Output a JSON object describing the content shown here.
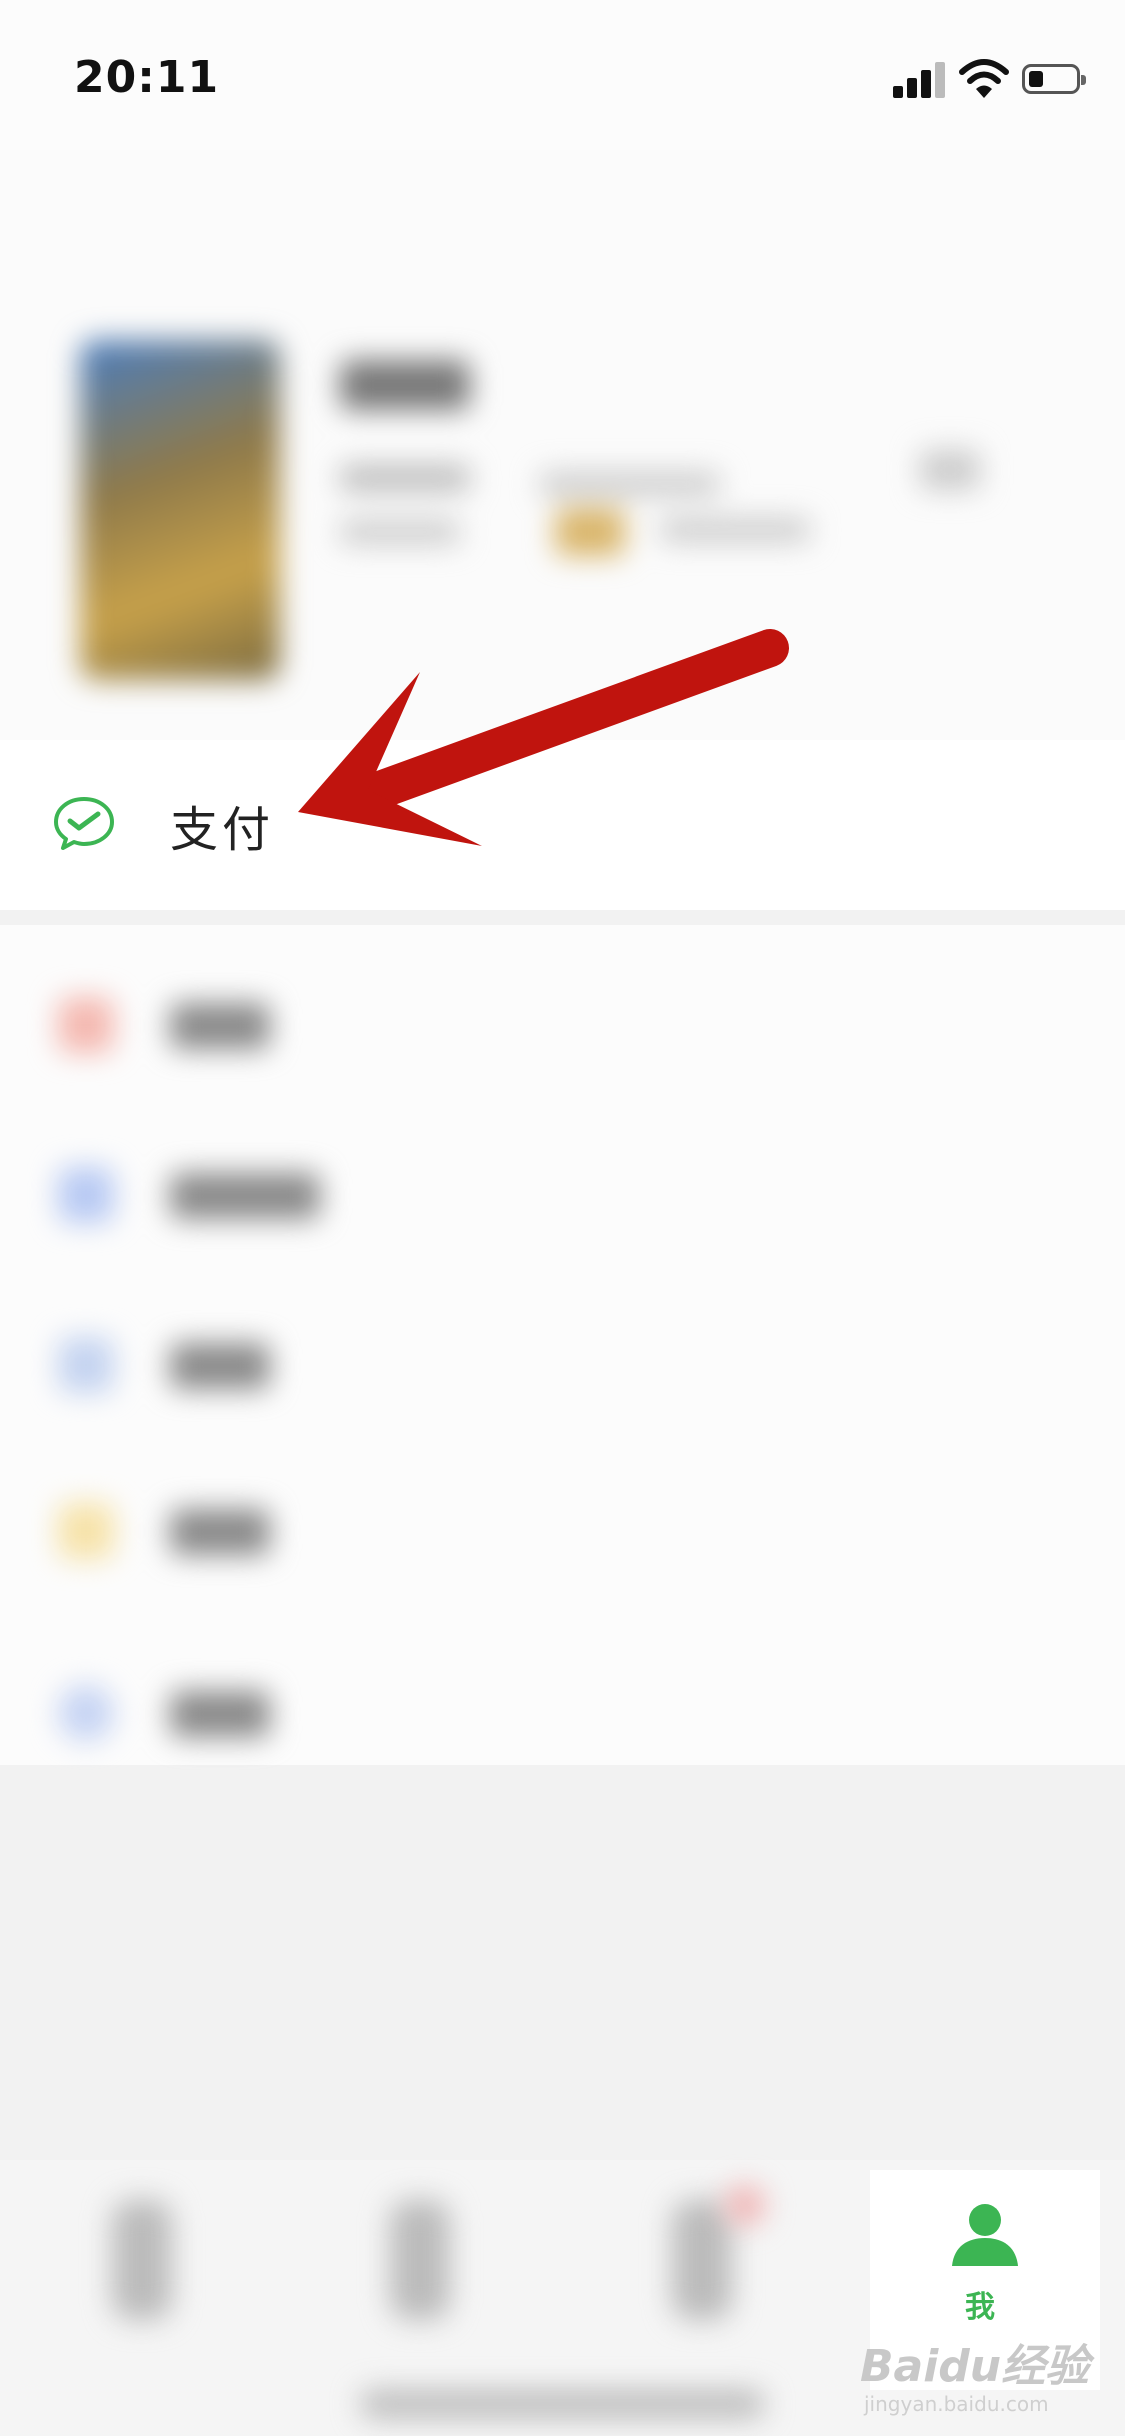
{
  "status_bar": {
    "time": "20:11"
  },
  "menu": {
    "pay_label": "支付"
  },
  "tab_bar": {
    "me_label": "我"
  },
  "watermark": {
    "logo": "Baidu经验",
    "url": "jingyan.baidu.com"
  },
  "colors": {
    "wechat_green": "#3cb553",
    "annotation_arrow": "#c0140e"
  },
  "icons": {
    "pay": "wechat-pay-icon",
    "me": "person-icon"
  }
}
